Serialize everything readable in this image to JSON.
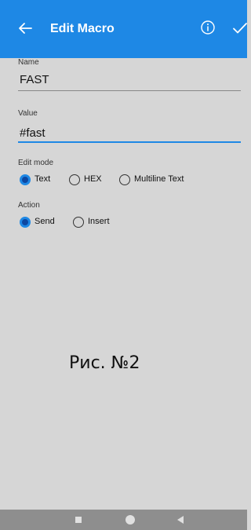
{
  "header": {
    "title": "Edit Macro",
    "back_icon": "arrow-left-icon",
    "info_icon": "info-circle-icon",
    "confirm_icon": "checkmark-icon",
    "background_color": "#1e88e5"
  },
  "form": {
    "name": {
      "label": "Name",
      "value": "FAST"
    },
    "value": {
      "label": "Value",
      "value": "#fast"
    },
    "edit_mode": {
      "label": "Edit mode",
      "options": [
        "Text",
        "HEX",
        "Multiline Text"
      ],
      "selected": "Text"
    },
    "action": {
      "label": "Action",
      "options": [
        "Send",
        "Insert"
      ],
      "selected": "Send"
    }
  },
  "caption": "Рис. №2",
  "navbar": {
    "recent_icon": "square-icon",
    "home_icon": "circle-icon",
    "back_icon": "triangle-back-icon"
  },
  "colors": {
    "accent": "#1e88e5",
    "background": "#d6d6d6",
    "navbar": "#8e8e8e"
  }
}
